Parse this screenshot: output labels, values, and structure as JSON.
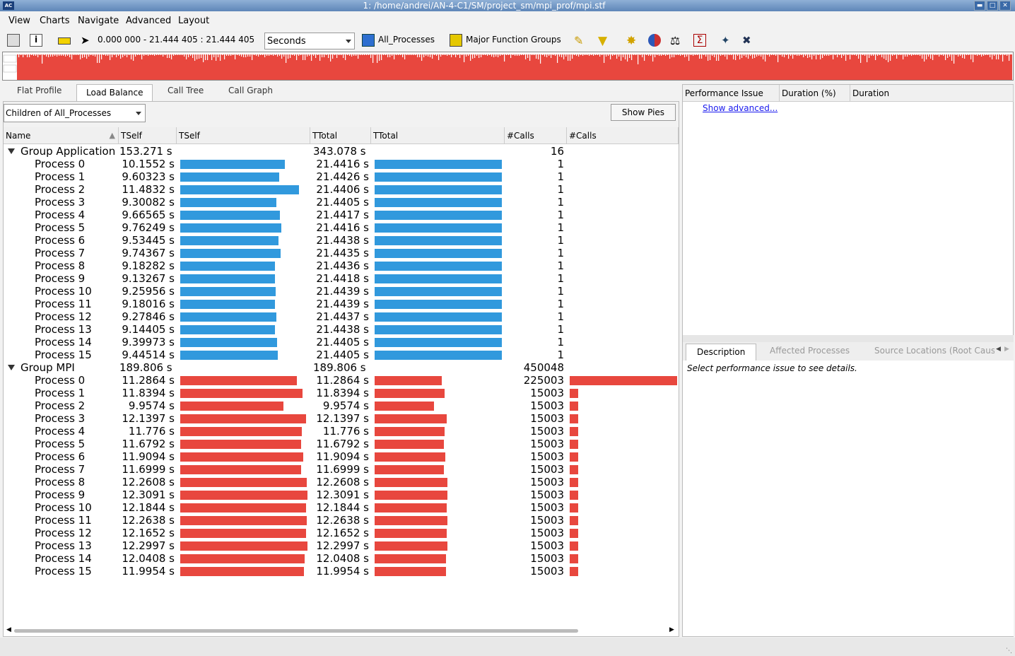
{
  "window": {
    "title": "1: /home/andrei/AN-4-C1/SM/project_sm/mpi_prof/mpi.stf",
    "app_icon": "AC"
  },
  "menu": [
    "View",
    "Charts",
    "Navigate",
    "Advanced",
    "Layout"
  ],
  "toolbar": {
    "time_range": "0.000 000 - 21.444 405 : 21.444 405",
    "unit_select": "Seconds",
    "process_filter": "All_Processes",
    "function_groups": "Major Function Groups"
  },
  "tabs": [
    "Flat Profile",
    "Load Balance",
    "Call Tree",
    "Call Graph"
  ],
  "active_tab": "Load Balance",
  "children_combo": "Children of  All_Processes",
  "show_pies": "Show Pies",
  "columns": [
    "Name",
    "TSelf",
    "TSelf",
    "TTotal",
    "TTotal",
    "#Calls",
    "#Calls"
  ],
  "colors": {
    "application": "#3199dd",
    "mpi": "#e8473e"
  },
  "groups": [
    {
      "name": "Group Application",
      "tself": "153.271 s",
      "ttotal": "343.078 s",
      "calls": "16",
      "processes": [
        {
          "name": "Process 0",
          "tself": "10.1552 s",
          "ttotal": "21.4416 s",
          "calls": "1"
        },
        {
          "name": "Process 1",
          "tself": "9.60323 s",
          "ttotal": "21.4426 s",
          "calls": "1"
        },
        {
          "name": "Process 2",
          "tself": "11.4832 s",
          "ttotal": "21.4406 s",
          "calls": "1"
        },
        {
          "name": "Process 3",
          "tself": "9.30082 s",
          "ttotal": "21.4405 s",
          "calls": "1"
        },
        {
          "name": "Process 4",
          "tself": "9.66565 s",
          "ttotal": "21.4417 s",
          "calls": "1"
        },
        {
          "name": "Process 5",
          "tself": "9.76249 s",
          "ttotal": "21.4416 s",
          "calls": "1"
        },
        {
          "name": "Process 6",
          "tself": "9.53445 s",
          "ttotal": "21.4438 s",
          "calls": "1"
        },
        {
          "name": "Process 7",
          "tself": "9.74367 s",
          "ttotal": "21.4435 s",
          "calls": "1"
        },
        {
          "name": "Process 8",
          "tself": "9.18282 s",
          "ttotal": "21.4436 s",
          "calls": "1"
        },
        {
          "name": "Process 9",
          "tself": "9.13267 s",
          "ttotal": "21.4418 s",
          "calls": "1"
        },
        {
          "name": "Process 10",
          "tself": "9.25956 s",
          "ttotal": "21.4439 s",
          "calls": "1"
        },
        {
          "name": "Process 11",
          "tself": "9.18016 s",
          "ttotal": "21.4439 s",
          "calls": "1"
        },
        {
          "name": "Process 12",
          "tself": "9.27846 s",
          "ttotal": "21.4437 s",
          "calls": "1"
        },
        {
          "name": "Process 13",
          "tself": "9.14405 s",
          "ttotal": "21.4438 s",
          "calls": "1"
        },
        {
          "name": "Process 14",
          "tself": "9.39973 s",
          "ttotal": "21.4405 s",
          "calls": "1"
        },
        {
          "name": "Process 15",
          "tself": "9.44514 s",
          "ttotal": "21.4405 s",
          "calls": "1"
        }
      ]
    },
    {
      "name": "Group MPI",
      "tself": "189.806 s",
      "ttotal": "189.806 s",
      "calls": "450048",
      "processes": [
        {
          "name": "Process 0",
          "tself": "11.2864 s",
          "ttotal": "11.2864 s",
          "calls": "225003"
        },
        {
          "name": "Process 1",
          "tself": "11.8394 s",
          "ttotal": "11.8394 s",
          "calls": "15003"
        },
        {
          "name": "Process 2",
          "tself": "9.9574 s",
          "ttotal": "9.9574 s",
          "calls": "15003"
        },
        {
          "name": "Process 3",
          "tself": "12.1397 s",
          "ttotal": "12.1397 s",
          "calls": "15003"
        },
        {
          "name": "Process 4",
          "tself": "11.776 s",
          "ttotal": "11.776 s",
          "calls": "15003"
        },
        {
          "name": "Process 5",
          "tself": "11.6792 s",
          "ttotal": "11.6792 s",
          "calls": "15003"
        },
        {
          "name": "Process 6",
          "tself": "11.9094 s",
          "ttotal": "11.9094 s",
          "calls": "15003"
        },
        {
          "name": "Process 7",
          "tself": "11.6999 s",
          "ttotal": "11.6999 s",
          "calls": "15003"
        },
        {
          "name": "Process 8",
          "tself": "12.2608 s",
          "ttotal": "12.2608 s",
          "calls": "15003"
        },
        {
          "name": "Process 9",
          "tself": "12.3091 s",
          "ttotal": "12.3091 s",
          "calls": "15003"
        },
        {
          "name": "Process 10",
          "tself": "12.1844 s",
          "ttotal": "12.1844 s",
          "calls": "15003"
        },
        {
          "name": "Process 11",
          "tself": "12.2638 s",
          "ttotal": "12.2638 s",
          "calls": "15003"
        },
        {
          "name": "Process 12",
          "tself": "12.1652 s",
          "ttotal": "12.1652 s",
          "calls": "15003"
        },
        {
          "name": "Process 13",
          "tself": "12.2997 s",
          "ttotal": "12.2997 s",
          "calls": "15003"
        },
        {
          "name": "Process 14",
          "tself": "12.0408 s",
          "ttotal": "12.0408 s",
          "calls": "15003"
        },
        {
          "name": "Process 15",
          "tself": "11.9954 s",
          "ttotal": "11.9954 s",
          "calls": "15003"
        }
      ]
    }
  ],
  "right": {
    "columns": [
      "Performance Issue",
      "Duration (%)",
      "Duration"
    ],
    "show_advanced": "Show advanced...",
    "tabs": [
      "Description",
      "Affected Processes",
      "Source Locations (Root Caus"
    ],
    "description": "Select performance issue to see details."
  }
}
